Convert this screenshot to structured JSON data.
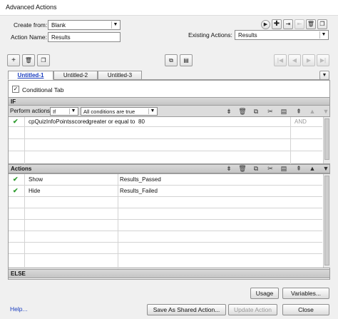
{
  "window": {
    "title": "Advanced Actions"
  },
  "form": {
    "create_from_label": "Create from:",
    "create_from_value": "Blank",
    "action_name_label": "Action Name:",
    "action_name_value": "Results",
    "existing_actions_label": "Existing Actions:",
    "existing_actions_value": "Results"
  },
  "tabs": [
    {
      "label": "Untitled-1"
    },
    {
      "label": "Untitled-2"
    },
    {
      "label": "Untitled-3"
    }
  ],
  "conditional_tab": {
    "label": "Conditional Tab",
    "checked": true
  },
  "if_section": {
    "label": "IF",
    "perform_actions_label": "Perform actions:",
    "perform_value": "If",
    "conditions_value": "All conditions are true",
    "rows": [
      {
        "variable": "cpQuizInfoPointsscored",
        "operator": "greater or equal to",
        "value": "80",
        "logic": "AND"
      }
    ]
  },
  "actions_section": {
    "label": "Actions",
    "rows": [
      {
        "action": "Show",
        "target": "Results_Passed"
      },
      {
        "action": "Hide",
        "target": "Results_Failed"
      }
    ]
  },
  "else_label": "ELSE",
  "buttons": {
    "usage": "Usage",
    "variables": "Variables...",
    "help": "Help...",
    "save_shared": "Save As Shared Action...",
    "update": "Update Action",
    "close": "Close"
  }
}
